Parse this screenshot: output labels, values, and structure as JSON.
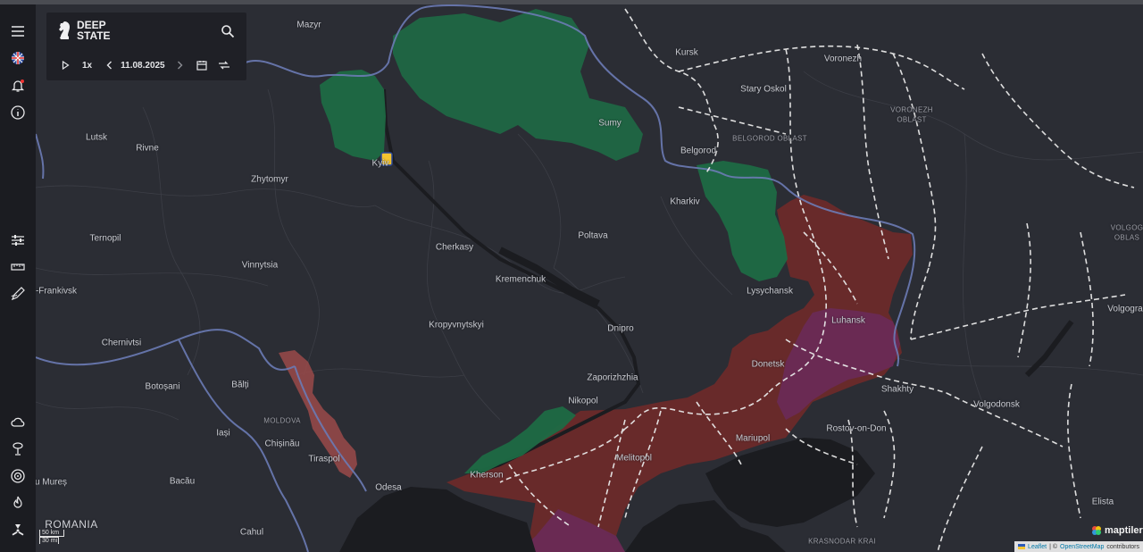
{
  "app": {
    "logo_text": "DEEP STATE",
    "playback_speed": "1x",
    "date": "11.08.2025"
  },
  "sidebar": {
    "top_icons": [
      "menu-icon",
      "flag-uk-icon",
      "bell-icon",
      "info-icon"
    ],
    "mid_icons": [
      "sliders-icon",
      "ruler-icon",
      "draw-icon"
    ],
    "bottom_icons": [
      "cloud-icon",
      "explosion-icon",
      "target-icon",
      "fire-icon",
      "radiation-icon"
    ]
  },
  "map": {
    "colors": {
      "background": "#2b2d34",
      "water": "#1b1c20",
      "occupied": "#6b2a2a",
      "pre_2022_occupied": "#6a2a55",
      "liberated": "#1e6a45",
      "transnistria": "#9a4a4a",
      "border": "#6b7bb5",
      "rail": "#e8e8e8"
    },
    "labels": {
      "mazyr": "Mazyr",
      "kursk": "Kursk",
      "voronezh": "Voronezh",
      "staryi_oskol": "Stary Oskol",
      "voronezh_oblast_1": "VORONEZH",
      "voronezh_oblast_2": "OBLAST",
      "lutsk": "Lutsk",
      "rivne": "Rivne",
      "sumy": "Sumy",
      "belgorod_oblast": "BELGOROD OBLAST",
      "belgorod": "Belgorod",
      "kyiv": "Kyiv",
      "zhytomyr": "Zhytomyr",
      "kharkiv": "Kharkiv",
      "ternopil": "Ternopil",
      "cherkasy": "Cherkasy",
      "poltava": "Poltava",
      "volgograd_oblast_1": "VOLGOG",
      "volgograd_oblast_2": "OBLAS",
      "vinnytsia": "Vinnytsia",
      "ivano_frankivsk": "-Frankivsk",
      "kremenchuk": "Kremenchuk",
      "lysychansk": "Lysychansk",
      "volgograd": "Volgogra",
      "luhansk": "Luhansk",
      "kropyvnytskyi": "Kropyvnytskyi",
      "dnipro": "Dnipro",
      "chernivtsi": "Chernivtsi",
      "donetsk": "Donetsk",
      "zaporizhzhia": "Zaporizhzhia",
      "botosani": "Botoșani",
      "balti": "Bălți",
      "shakhty": "Shakhty",
      "nikopol": "Nikopol",
      "volgodonsk": "Volgodonsk",
      "moldova": "MOLDOVA",
      "rostov": "Rostov-on-Don",
      "iasi": "Iași",
      "mariupol": "Mariupol",
      "chisinau": "Chișinău",
      "melitopol": "Melitopol",
      "tiraspol": "Tiraspol",
      "kherson": "Kherson",
      "mures": "u Mureș",
      "bacau": "Bacău",
      "odesa": "Odesa",
      "elista": "Elista",
      "romania": "ROMANIA",
      "cahul": "Cahul",
      "krasnodar": "KRASNODAR KRAI"
    },
    "scale": {
      "km": "50 km",
      "mi": "30 mi"
    },
    "attribution": {
      "leaflet": "Leaflet",
      "separator": "| ©",
      "osm": "OpenStreetMap",
      "contributors": "contributors"
    },
    "maptiler": "maptiler"
  }
}
